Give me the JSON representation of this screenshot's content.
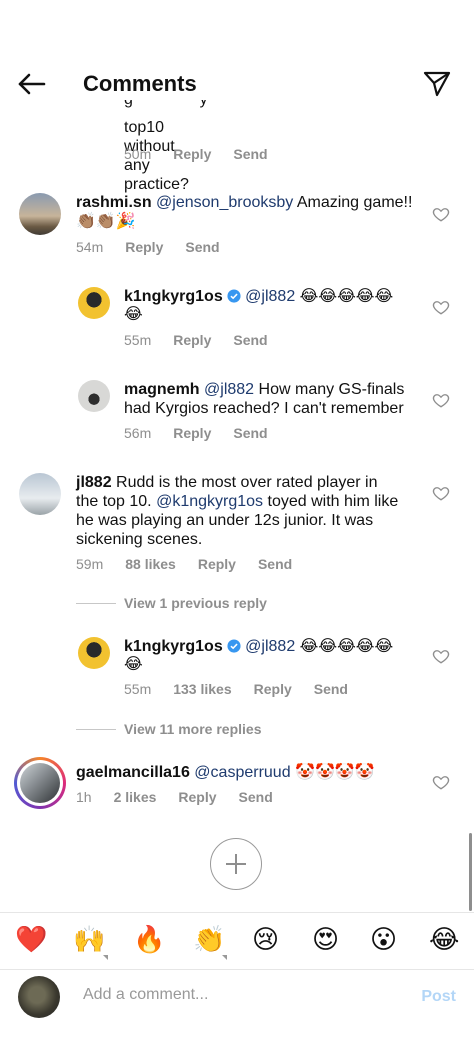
{
  "header": {
    "title": "Comments"
  },
  "comments": [
    {
      "text_line1": "top10 without any practice?",
      "time": "50m",
      "reply": "Reply",
      "send": "Send"
    },
    {
      "user": "rashmi.sn",
      "mention": "@jenson_brooksby",
      "body": "Amazing game!!",
      "emojis": "👏🏽👏🏽🎉",
      "time": "54m",
      "reply": "Reply",
      "send": "Send"
    },
    {
      "user": "k1ngkyrg1os",
      "mention": "@jl882",
      "emojis1": "😂😂😂😂😂",
      "emojis2": "😂",
      "time": "55m",
      "reply": "Reply",
      "send": "Send"
    },
    {
      "user": "magnemh",
      "mention": "@jl882",
      "body1": "How many GS-finals",
      "body2": "had Kyrgios reached? I can't remember",
      "time": "56m",
      "reply": "Reply",
      "send": "Send"
    },
    {
      "user": "jl882",
      "body1": "Rudd is the most over rated player in",
      "body2a": "the top 10.",
      "mention": "@k1ngkyrg1os",
      "body2b": "toyed with him like",
      "body3": "he was playing an under 12s junior. It was",
      "body4": "sickening scenes.",
      "time": "59m",
      "likes": "88 likes",
      "reply": "Reply",
      "send": "Send",
      "view_replies": "View 1 previous reply"
    },
    {
      "user": "k1ngkyrg1os",
      "mention": "@jl882",
      "emojis1": "😂😂😂😂😂",
      "emojis2": "😂",
      "time": "55m",
      "likes": "133 likes",
      "reply": "Reply",
      "send": "Send",
      "view_replies": "View 11 more replies"
    },
    {
      "user": "gaelmancilla16",
      "mention": "@casperruud",
      "emojis": "🤡🤡🤡🤡",
      "time": "1h",
      "likes": "2 likes",
      "reply": "Reply",
      "send": "Send"
    }
  ],
  "reactions": [
    "❤️",
    "🙌",
    "🔥",
    "👏",
    "😢",
    "😍",
    "😮",
    "😂"
  ],
  "composer": {
    "placeholder": "Add a comment...",
    "post": "Post"
  }
}
